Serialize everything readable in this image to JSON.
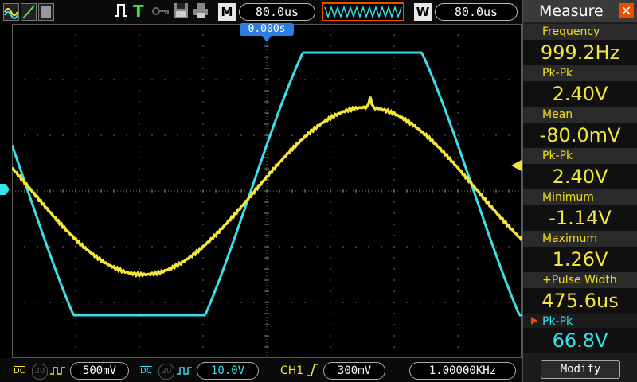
{
  "top_bar": {
    "timebase": "80.0us",
    "mode_m": "M",
    "mode_w": "W",
    "window_timebase": "80.0us",
    "trigger_mark": "T",
    "trigger_time": "0.000s"
  },
  "bottom_bar": {
    "ch1_coupling": "DC",
    "ch1_bw": "20",
    "ch1_scale": "500mV",
    "ch2_coupling": "DC",
    "ch2_bw": "20",
    "ch2_scale": "10.0V",
    "trigger_source": "CH1",
    "trigger_level": "300mV",
    "trigger_frequency": "1.00000KHz"
  },
  "measure_panel": {
    "title": "Measure",
    "items": [
      {
        "label": "Frequency",
        "value": "999.2Hz"
      },
      {
        "label": "Pk-Pk",
        "value": "2.40V"
      },
      {
        "label": "Mean",
        "value": "-80.0mV"
      },
      {
        "label": "Pk-Pk",
        "value": "2.40V"
      },
      {
        "label": "Minimum",
        "value": "-1.14V"
      },
      {
        "label": "Maximum",
        "value": "1.26V"
      },
      {
        "label": "+Pulse Width",
        "value": "475.6us"
      },
      {
        "label": "Pk-Pk",
        "value": "66.8V"
      }
    ],
    "modify_label": "Modify"
  },
  "colors": {
    "ch1": "#f5e63a",
    "ch2": "#38e0ea",
    "accent": "#e85000",
    "grid": "#5a5a5a"
  }
}
